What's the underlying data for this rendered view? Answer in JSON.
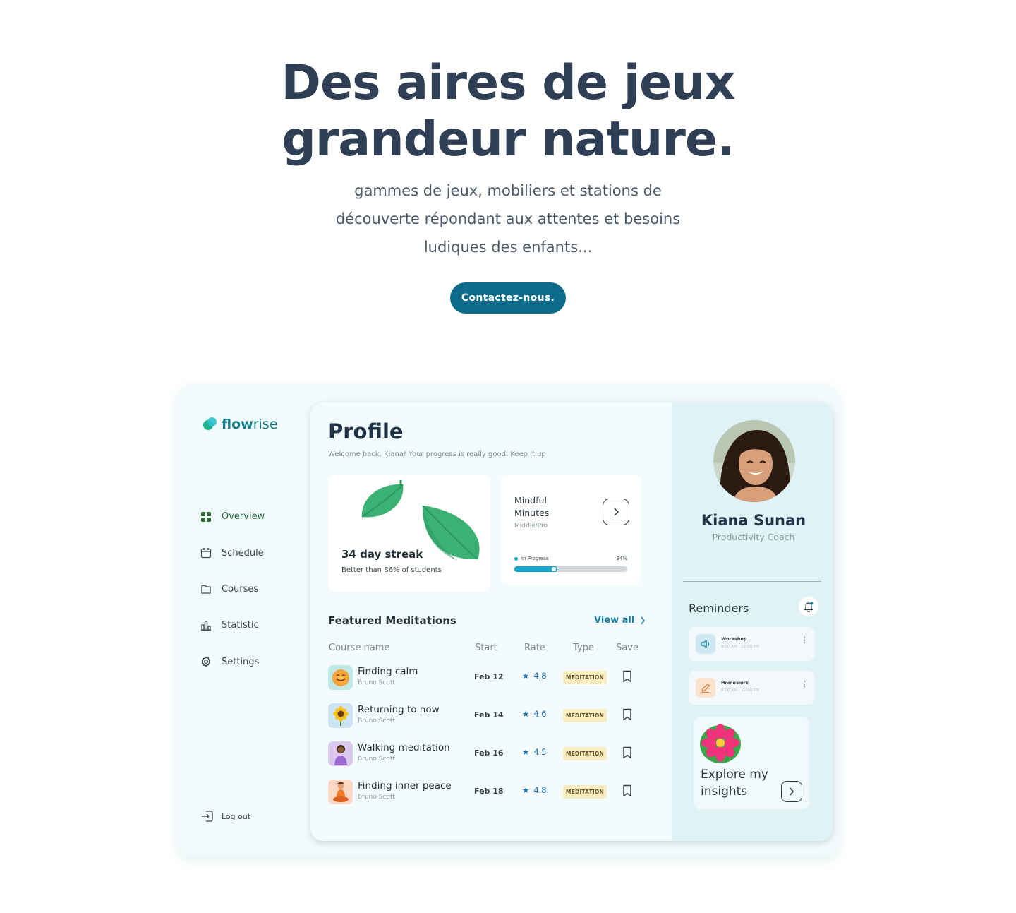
{
  "hero": {
    "title_line1": "Des aires de jeux",
    "title_line2": "grandeur nature.",
    "subtitle": "gammes de jeux, mobiliers et stations de découverte répondant aux attentes et besoins ludiques des enfants...",
    "cta_label": "Contactez-nous."
  },
  "app": {
    "logo": {
      "bold": "flow",
      "light": "rise"
    },
    "nav": [
      {
        "label": "Overview",
        "icon": "grid-icon"
      },
      {
        "label": "Schedule",
        "icon": "calendar-icon"
      },
      {
        "label": "Courses",
        "icon": "folder-icon"
      },
      {
        "label": "Statistic",
        "icon": "bar-chart-icon"
      },
      {
        "label": "Settings",
        "icon": "gear-icon"
      }
    ],
    "logout": "Log out",
    "profile": {
      "title": "Profile",
      "welcome": "Welcome back, Kiana! Your progress is really good. Keep it up"
    },
    "streak": {
      "title": "34 day streak",
      "subtitle": "Better than 86% of students"
    },
    "mindful": {
      "title": "Mindful Minutes",
      "level": "Middle/Pro",
      "status": "In Progress",
      "percent_label": "34%",
      "progress": 0.38
    },
    "featured": {
      "title": "Featured Meditations",
      "view_all": "View all",
      "headers": {
        "name": "Course name",
        "start": "Start",
        "rate": "Rate",
        "type": "Type",
        "save": "Save"
      },
      "rows": [
        {
          "name": "Finding calm",
          "author": "Bruno Scott",
          "date": "Feb 12",
          "rate": "4.8",
          "type": "MEDITATION",
          "icon": "smiley-icon"
        },
        {
          "name": "Returning to now",
          "author": "Bruno Scott",
          "date": "Feb 14",
          "rate": "4.6",
          "type": "MEDITATION",
          "icon": "sunflower-icon"
        },
        {
          "name": "Walking meditation",
          "author": "Bruno Scott",
          "date": "Feb 16",
          "rate": "4.5",
          "type": "MEDITATION",
          "icon": "person-icon"
        },
        {
          "name": "Finding inner peace",
          "author": "Bruno Scott",
          "date": "Feb 18",
          "rate": "4.8",
          "type": "MEDITATION",
          "icon": "meditating-person-icon"
        }
      ]
    },
    "user": {
      "name": "Kiana Sunan",
      "role": "Productivity Coach"
    },
    "reminders": {
      "title": "Reminders",
      "items": [
        {
          "name": "Workshop",
          "time": "8:00 AM - 12:00 PM",
          "icon": "speaker-icon",
          "color": "#cfe8f2"
        },
        {
          "name": "Homework",
          "time": "8:00 AM - 12:00 PM",
          "icon": "pencil-icon",
          "color": "#fbe3cf"
        }
      ]
    },
    "insights": {
      "label": "Explore my insights"
    }
  },
  "colors": {
    "accent": "#0f6b8a",
    "progress": "#19a8c9",
    "star": "#1a6fb0",
    "badge": "#f8ecc2"
  }
}
